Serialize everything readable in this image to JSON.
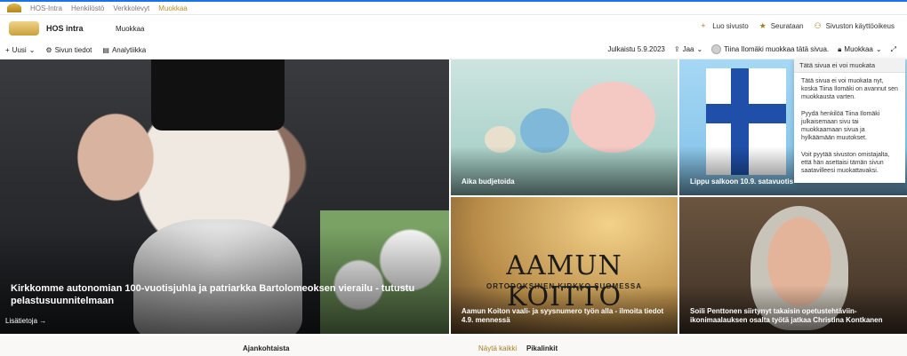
{
  "topnav": {
    "items": [
      "HOS-Intra",
      "Henkilöstö",
      "Verkkolevyt",
      "Muokkaa"
    ]
  },
  "header": {
    "title": "HOS intra",
    "edit": "Muokkaa",
    "actions": [
      "Luo sivusto",
      "Seurataan",
      "Sivuston käyttöoikeus"
    ]
  },
  "toolbar": {
    "new": "Uusi",
    "page_details": "Sivun tiedot",
    "analytics": "Analytiikka",
    "published": "Julkaistu 5.9.2023",
    "share": "Jaa",
    "editing_user": "Tiina Ilomäki muokkaa tätä sivua.",
    "edit": "Muokkaa"
  },
  "tiles": [
    {
      "title": "Kirkkomme autonomian 100-vuotisjuhla ja patriarkka Bartolomeoksen vierailu - tutustu pelastusuunnitelmaan",
      "more": "Lisätietoja →"
    },
    {
      "title": "Aika budjetoida"
    },
    {
      "title": "Lippu salkoon 10.9. satavuotis"
    },
    {
      "title": "Aamun Koiton vaali- ja syysnumero työn alla - ilmoita tiedot 4.9. mennessä",
      "logo_text": "AAMUN KOITTO",
      "logo_sub": "ORTODOKSINEN KIRKKO SUOMESSA"
    },
    {
      "title": "Soili Penttonen siirtynyt takaisin opetustehtäviin- ikonimaalauksen osalta työtä jatkaa Christina Kontkanen"
    }
  ],
  "popup": {
    "title": "Tätä sivua ei voi muokata",
    "p1": "Tätä sivua ei voi muokata nyt, koska Tiina Ilomäki on avannut sen muokkausta varten.",
    "p2": "Pyydä henkilöä Tiina Ilomäki julkaisemaan sivu tai muokkaamaan sivua ja hylkäämään muutokset.",
    "p3": "Voit pyytää sivuston omistajalta, että hän asettaisi tämän sivun saatavilleesi muokattavaksi."
  },
  "bottom": {
    "news": "Ajankohtaista",
    "see_all": "Näytä kaikki",
    "quick_links": "Pikalinkit"
  }
}
